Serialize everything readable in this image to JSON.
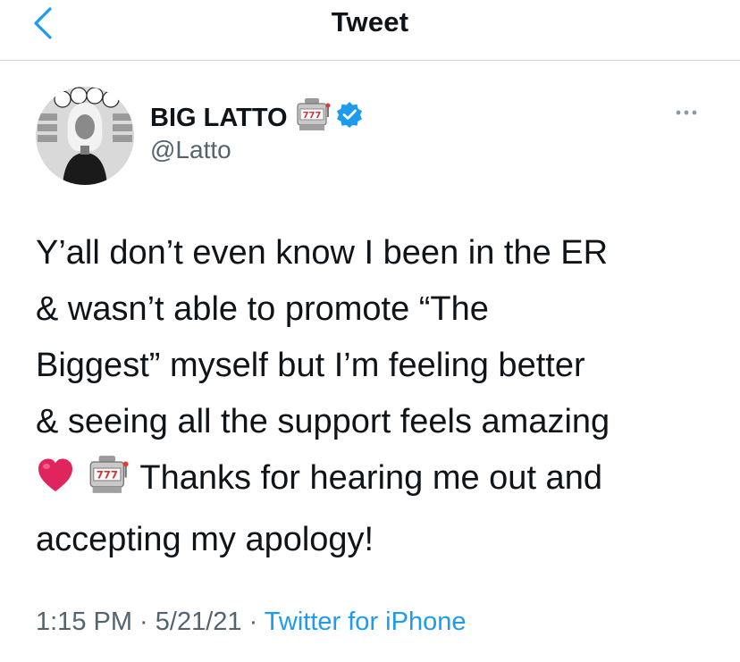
{
  "header": {
    "title": "Tweet",
    "back_icon": "chevron-left-icon"
  },
  "colors": {
    "accent": "#1d9bf0",
    "secondary_text": "#536471",
    "primary_text": "#0f1419",
    "divider": "#cfd9de",
    "heart": "#e0245e"
  },
  "author": {
    "display_name": "BIG LATTO",
    "name_emoji": "slot-machine-icon",
    "verified_icon": "verified-badge-icon",
    "handle": "@Latto",
    "avatar_icon": "avatar-image"
  },
  "more_icon": "more-dots-icon",
  "tweet": {
    "text_part1": "Y’all don’t even know I been in the ER\n& wasn’t able to promote “The\nBiggest” myself but I’m feeling better\n& seeing all the support feels amazing\n",
    "emoji_1": "red-heart-icon",
    "emoji_2": "slot-machine-icon",
    "text_part2": " Thanks for hearing me out and\naccepting my apology!"
  },
  "meta": {
    "time": "1:15 PM",
    "separator": " · ",
    "date": "5/21/21",
    "source": "Twitter for iPhone"
  }
}
